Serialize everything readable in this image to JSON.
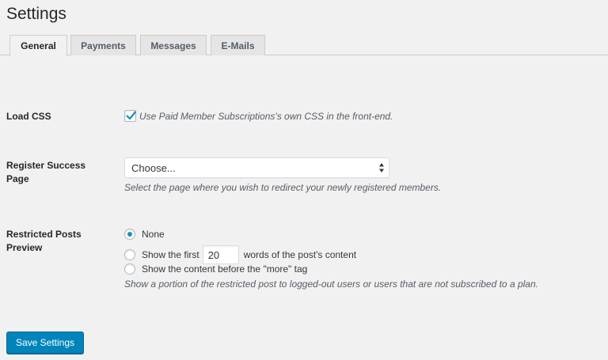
{
  "page": {
    "title": "Settings"
  },
  "tabs": [
    {
      "label": "General",
      "active": true
    },
    {
      "label": "Payments",
      "active": false
    },
    {
      "label": "Messages",
      "active": false
    },
    {
      "label": "E-Mails",
      "active": false
    }
  ],
  "load_css": {
    "label": "Load CSS",
    "checked": true,
    "checkbox_text": "Use Paid Member Subscriptions's own CSS in the front-end."
  },
  "register_success": {
    "label": "Register Success Page",
    "selected": "Choose...",
    "description": "Select the page where you wish to redirect your newly registered members."
  },
  "restricted_preview": {
    "label": "Restricted Posts Preview",
    "option_none": "None",
    "option_first_prefix": "Show the first",
    "words_value": "20",
    "option_first_suffix": "words of the post's content",
    "option_more": "Show the content before the \"more\" tag",
    "selected": "none",
    "description": "Show a portion of the restricted post to logged-out users or users that are not subscribed to a plan."
  },
  "save_button": {
    "label": "Save Settings"
  },
  "colors": {
    "accent": "#0085ba",
    "background": "#f1f1f1"
  }
}
